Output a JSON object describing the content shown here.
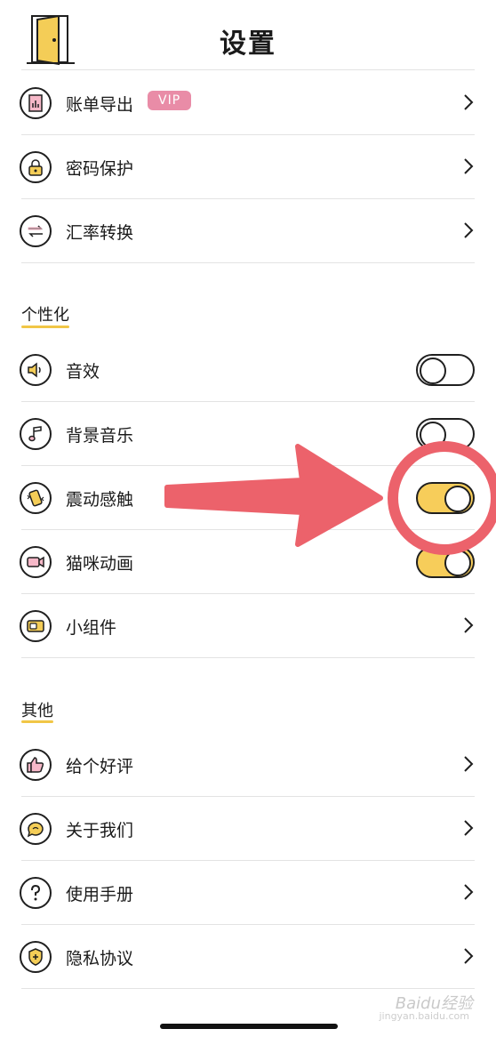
{
  "header": {
    "title": "设置"
  },
  "top_items": [
    {
      "label": "账单导出",
      "badge": "VIP",
      "icon": "chart-doc-icon"
    },
    {
      "label": "密码保护",
      "icon": "lock-icon"
    },
    {
      "label": "汇率转换",
      "icon": "exchange-icon"
    }
  ],
  "sections": {
    "personalize": {
      "title": "个性化",
      "items": [
        {
          "label": "音效",
          "icon": "speaker-icon",
          "toggle": false
        },
        {
          "label": "背景音乐",
          "icon": "music-note-icon",
          "toggle": false
        },
        {
          "label": "震动感触",
          "icon": "vibrate-phone-icon",
          "toggle": true
        },
        {
          "label": "猫咪动画",
          "icon": "video-camera-icon",
          "toggle": true
        },
        {
          "label": "小组件",
          "icon": "widget-icon"
        }
      ]
    },
    "other": {
      "title": "其他",
      "items": [
        {
          "label": "给个好评",
          "icon": "thumbs-up-icon"
        },
        {
          "label": "关于我们",
          "icon": "chat-bubble-icon"
        },
        {
          "label": "使用手册",
          "icon": "question-icon"
        },
        {
          "label": "隐私协议",
          "icon": "shield-plus-icon"
        }
      ]
    }
  },
  "watermark": {
    "text": "Baidu经验",
    "sub": "jingyan.baidu.com"
  },
  "colors": {
    "accent_yellow": "#f7cd5a",
    "vip_pink": "#e98ca7",
    "annotation_red": "#ec626b"
  }
}
